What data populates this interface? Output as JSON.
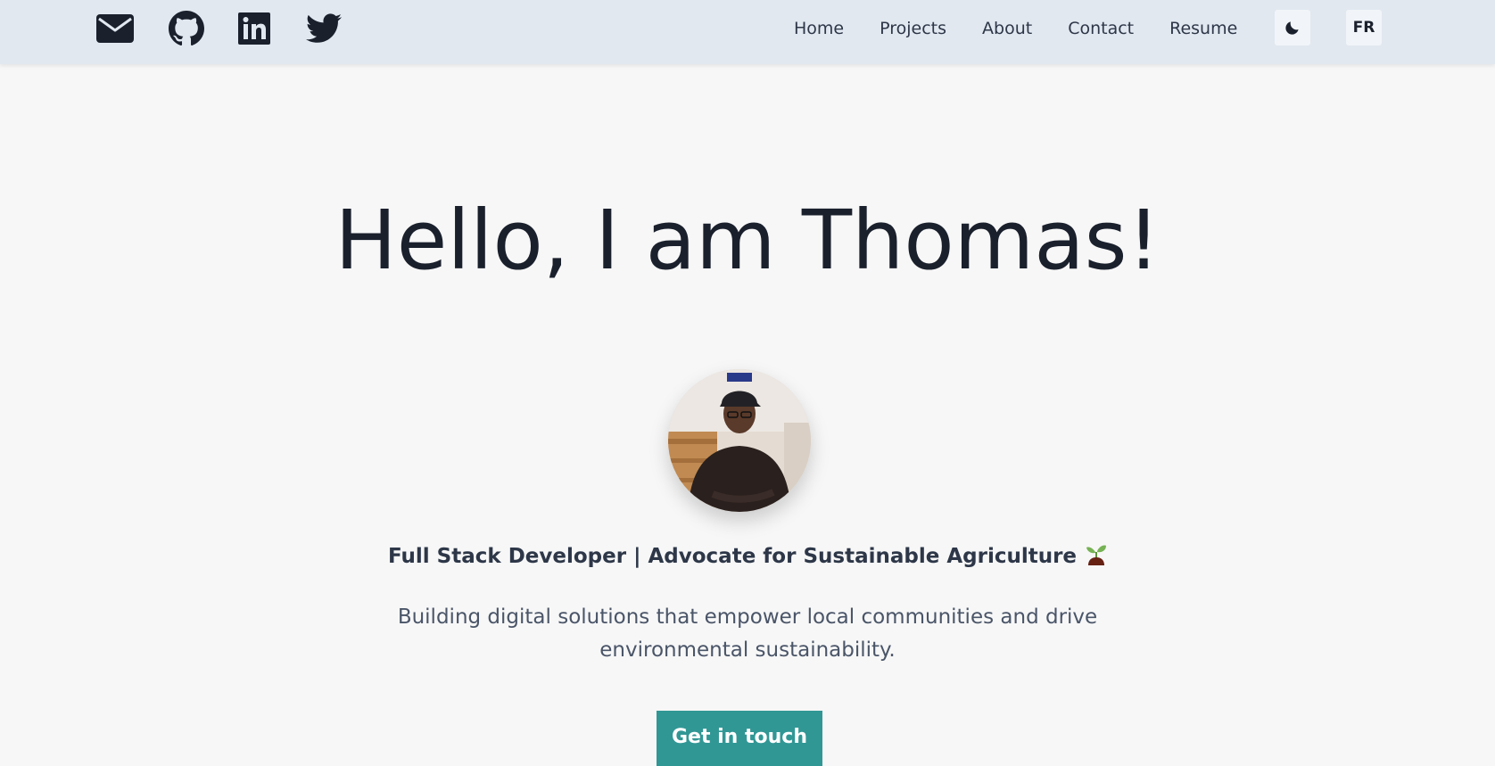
{
  "header": {
    "social_links": [
      {
        "icon": "envelope-icon",
        "label": "Email"
      },
      {
        "icon": "github-icon",
        "label": "GitHub"
      },
      {
        "icon": "linkedin-icon",
        "label": "LinkedIn"
      },
      {
        "icon": "twitter-icon",
        "label": "Twitter"
      }
    ],
    "nav": {
      "home": "Home",
      "projects": "Projects",
      "about": "About",
      "contact": "Contact",
      "resume": "Resume"
    },
    "theme_toggle_icon": "moon-icon",
    "language_label": "FR"
  },
  "hero": {
    "title": "Hello, I am Thomas!",
    "avatar_icon": "profile-photo",
    "subtitle": "Full Stack Developer | Advocate for Sustainable Agriculture",
    "subtitle_icon": "seedling-icon",
    "description": "Building digital solutions that empower local communities and drive environmental sustainability.",
    "cta_label": "Get in touch"
  },
  "colors": {
    "header_bg": "#e2e8f0",
    "page_bg": "#f7f7f7",
    "accent": "#319795",
    "text_dark": "#1a202c",
    "text_muted": "#4a5568"
  }
}
